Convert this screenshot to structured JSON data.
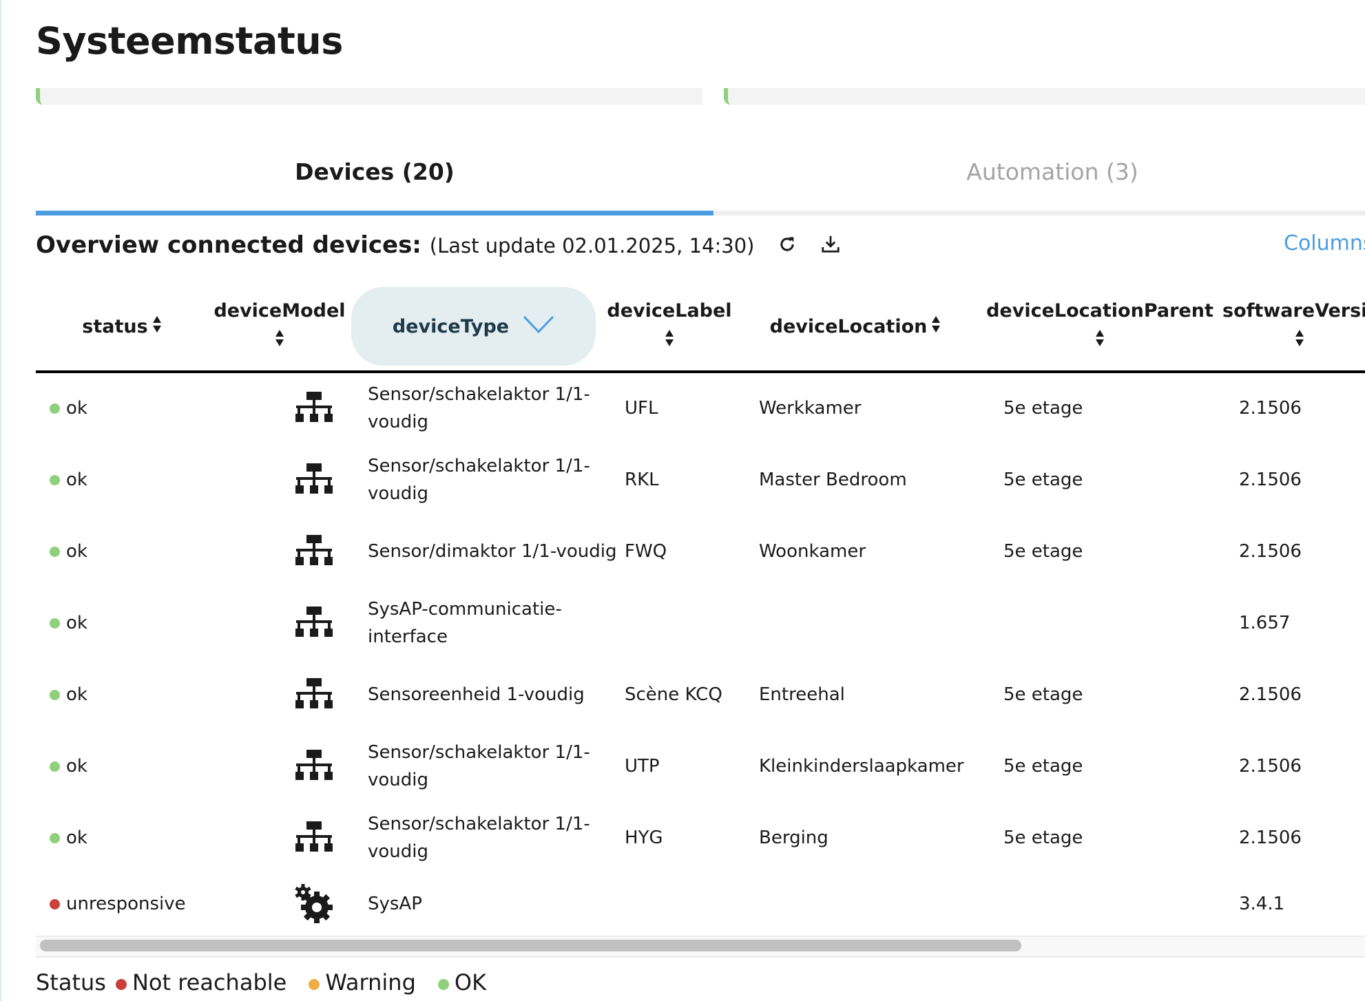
{
  "page": {
    "title": "Systeemstatus"
  },
  "tabs": [
    {
      "label": "Devices (20)",
      "active": true
    },
    {
      "label": "Automation (3)",
      "active": false
    }
  ],
  "overview": {
    "title": "Overview connected devices:",
    "last_update": "(Last update 02.01.2025, 14:30)",
    "columns_link": "Columns"
  },
  "table": {
    "headers": [
      "status",
      "deviceModel",
      "deviceType",
      "deviceLabel",
      "deviceLocation",
      "deviceLocationParent",
      "softwareVersio"
    ],
    "sorted_column": "deviceType",
    "rows": [
      {
        "status": "ok",
        "status_color": "#8fd07a",
        "model_icon": "network-icon",
        "type": "Sensor/schakelaktor 1/1-voudig",
        "label": "UFL",
        "location": "Werkkamer",
        "parent": "5e etage",
        "version": "2.1506"
      },
      {
        "status": "ok",
        "status_color": "#8fd07a",
        "model_icon": "network-icon",
        "type": "Sensor/schakelaktor 1/1-voudig",
        "label": "RKL",
        "location": "Master Bedroom",
        "parent": "5e etage",
        "version": "2.1506"
      },
      {
        "status": "ok",
        "status_color": "#8fd07a",
        "model_icon": "network-icon",
        "type": "Sensor/dimaktor 1/1-voudig",
        "label": "FWQ",
        "location": "Woonkamer",
        "parent": "5e etage",
        "version": "2.1506"
      },
      {
        "status": "ok",
        "status_color": "#8fd07a",
        "model_icon": "network-icon",
        "type": "SysAP-communicatie-interface",
        "label": "",
        "location": "",
        "parent": "",
        "version": "1.657"
      },
      {
        "status": "ok",
        "status_color": "#8fd07a",
        "model_icon": "network-icon",
        "type": "Sensoreenheid 1-voudig",
        "label": "Scène KCQ",
        "location": "Entreehal",
        "parent": "5e etage",
        "version": "2.1506"
      },
      {
        "status": "ok",
        "status_color": "#8fd07a",
        "model_icon": "network-icon",
        "type": "Sensor/schakelaktor 1/1-voudig",
        "label": "UTP",
        "location": "Kleinkinderslaapkamer",
        "parent": "5e etage",
        "version": "2.1506"
      },
      {
        "status": "ok",
        "status_color": "#8fd07a",
        "model_icon": "network-icon",
        "type": "Sensor/schakelaktor 1/1-voudig",
        "label": "HYG",
        "location": "Berging",
        "parent": "5e etage",
        "version": "2.1506"
      },
      {
        "status": "unresponsive",
        "status_color": "#c9403a",
        "model_icon": "gear-icon",
        "type": "SysAP",
        "label": "",
        "location": "",
        "parent": "",
        "version": "3.4.1"
      }
    ]
  },
  "legend": {
    "title": "Status",
    "items": [
      {
        "label": "Not reachable",
        "color": "#c9403a"
      },
      {
        "label": "Warning",
        "color": "#f0ad45"
      },
      {
        "label": "OK",
        "color": "#8fd07a"
      }
    ]
  },
  "colors": {
    "accent": "#4a9de0",
    "progress": "#8fd07a"
  }
}
